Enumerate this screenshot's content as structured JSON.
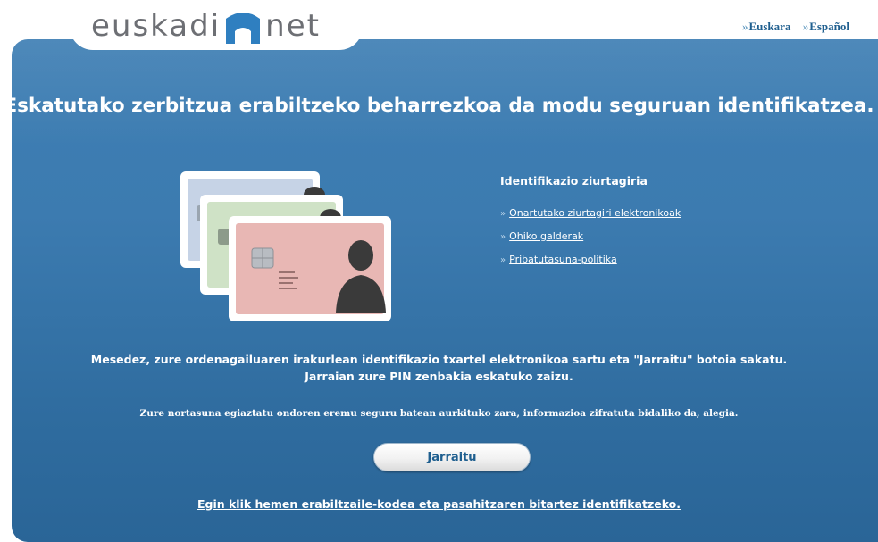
{
  "header": {
    "logo": {
      "left_text": "euskadi",
      "right_text": "net",
      "icon": "bridge-logo-icon"
    },
    "languages": [
      {
        "prefix": "»",
        "label": "Euskara"
      },
      {
        "prefix": "»",
        "label": "Español"
      }
    ]
  },
  "main": {
    "headline": "Eskatutako zerbitzua erabiltzeko beharrezkoa da modu seguruan identifikatzea.",
    "illustration": "id-cards-icon",
    "info": {
      "title": "Identifikazio ziurtagiria",
      "links": [
        {
          "prefix": "»",
          "label": "Onartutako ziurtagiri elektronikoak"
        },
        {
          "prefix": "»",
          "label": "Ohiko galderak"
        },
        {
          "prefix": "»",
          "label": "Pribatutasuna-politika"
        }
      ]
    },
    "instructions_line1": "Mesedez, zure ordenagailuaren irakurlean identifikazio txartel elektronikoa sartu eta \"Jarraitu\" botoia sakatu.",
    "instructions_line2": "Jarraian zure PIN zenbakia eskatuko zaizu.",
    "note": "Zure nortasuna egiaztatu ondoren eremu seguru batean aurkituko zara, informazioa zifratuta bidaliko da, alegia.",
    "continue_label": "Jarraitu",
    "alt_link": "Egin klik hemen erabiltzaile-kodea eta pasahitzaren bitartez identifikatzeko."
  },
  "colors": {
    "panel_blue": "#3c7bb0",
    "link_blue": "#1f5f8f",
    "logo_grey": "#6d6f74"
  }
}
